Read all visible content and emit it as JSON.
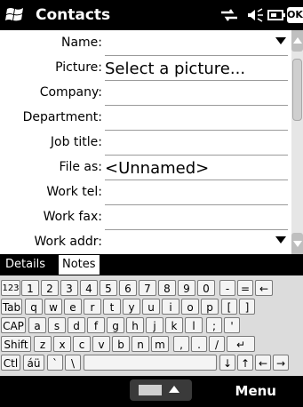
{
  "titlebar": {
    "title": "Contacts",
    "ok_label": "OK"
  },
  "form": {
    "fields": [
      {
        "label": "Name:",
        "value": ""
      },
      {
        "label": "Picture:",
        "value": "Select a picture..."
      },
      {
        "label": "Company:",
        "value": ""
      },
      {
        "label": "Department:",
        "value": ""
      },
      {
        "label": "Job title:",
        "value": ""
      },
      {
        "label": "File as:",
        "value": "<Unnamed>"
      },
      {
        "label": "Work tel:",
        "value": ""
      },
      {
        "label": "Work fax:",
        "value": ""
      },
      {
        "label": "Work addr:",
        "value": ""
      }
    ]
  },
  "tabs": {
    "details": "Details",
    "notes": "Notes"
  },
  "keyboard": {
    "row1": [
      "123",
      "1",
      "2",
      "3",
      "4",
      "5",
      "6",
      "7",
      "8",
      "9",
      "0",
      "-",
      "=",
      "←"
    ],
    "row2": [
      "Tab",
      "q",
      "w",
      "e",
      "r",
      "t",
      "y",
      "u",
      "i",
      "o",
      "p",
      "[",
      "]"
    ],
    "row3": [
      "CAP",
      "a",
      "s",
      "d",
      "f",
      "g",
      "h",
      "j",
      "k",
      "l",
      ";",
      "'"
    ],
    "row4": [
      "Shift",
      "z",
      "x",
      "c",
      "v",
      "b",
      "n",
      "m",
      ",",
      ".",
      "/",
      "↵"
    ],
    "row5": [
      "Ctl",
      "áü",
      "`",
      "\\",
      "",
      "↓",
      "↑",
      "←",
      "→"
    ]
  },
  "bottombar": {
    "menu_label": "Menu"
  }
}
